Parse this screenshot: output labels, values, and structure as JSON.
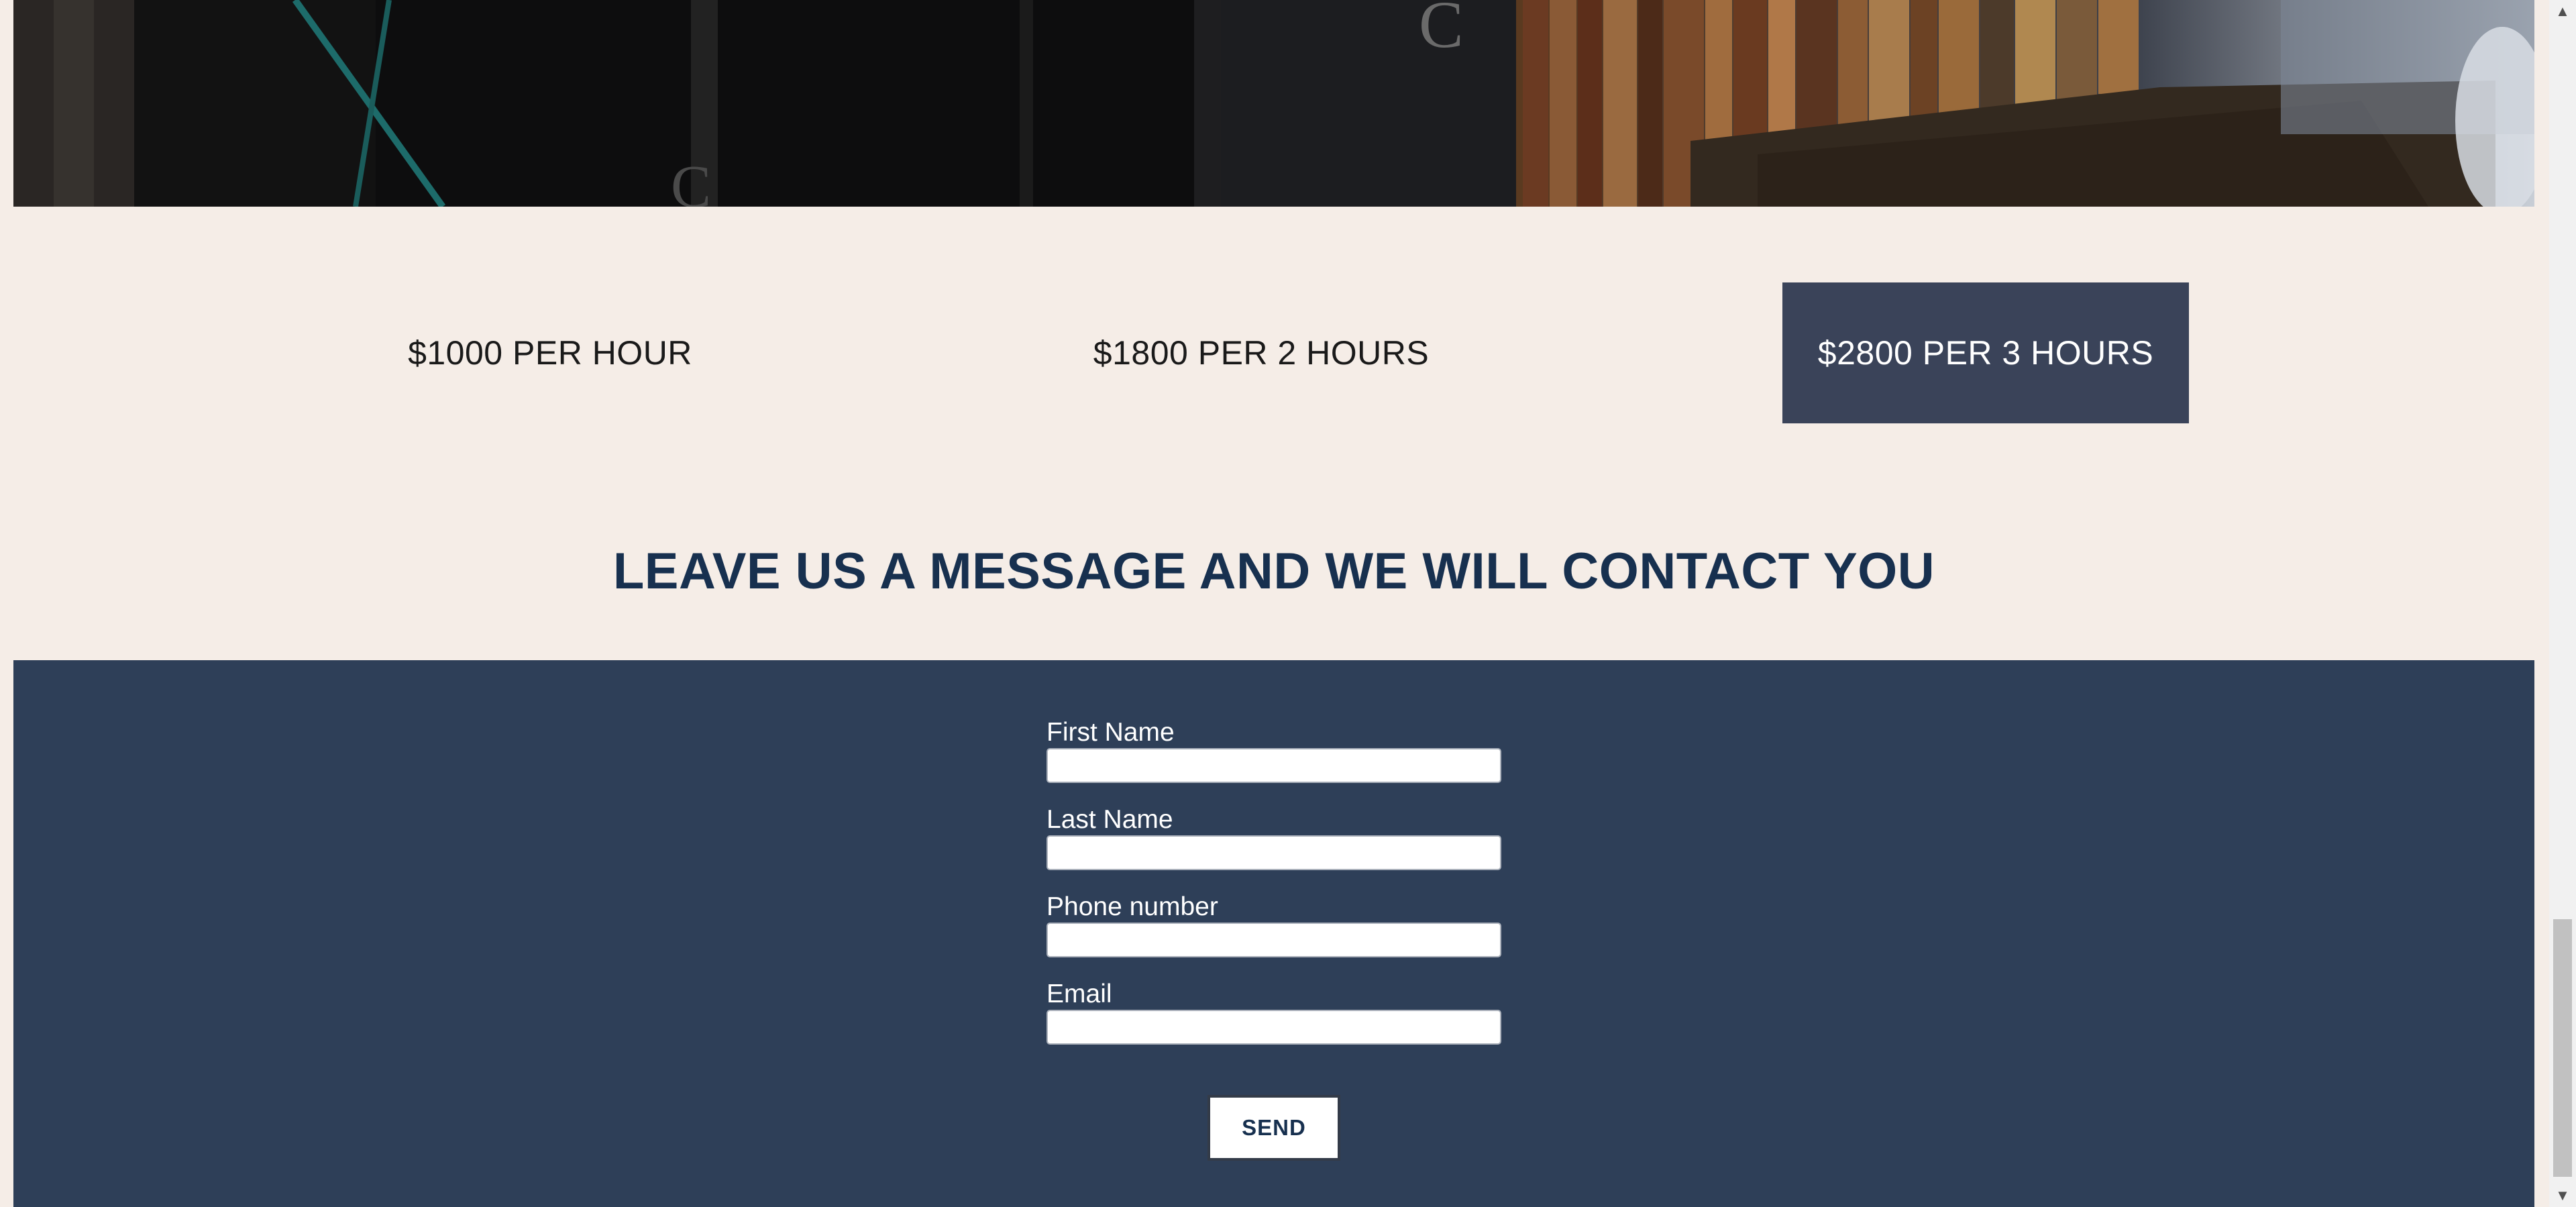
{
  "pricing": {
    "options": [
      {
        "label": "$1000 PER HOUR",
        "selected": false
      },
      {
        "label": "$1800 PER 2 HOURS",
        "selected": false
      },
      {
        "label": "$2800 PER 3 HOURS",
        "selected": true
      }
    ]
  },
  "contact": {
    "heading": "LEAVE US A MESSAGE AND WE WILL CONTACT YOU",
    "fields": [
      {
        "label": "First Name",
        "value": ""
      },
      {
        "label": "Last Name",
        "value": ""
      },
      {
        "label": "Phone number",
        "value": ""
      },
      {
        "label": "Email",
        "value": ""
      }
    ],
    "submit_label": "SEND"
  },
  "scrollbar": {
    "up_icon": "chevron-up-icon",
    "down_icon": "chevron-down-icon"
  },
  "colors": {
    "page_background": "#f5ede7",
    "selected_price_bg": "#3a4359",
    "form_background": "#2e3f58",
    "heading_color": "#17304f"
  }
}
